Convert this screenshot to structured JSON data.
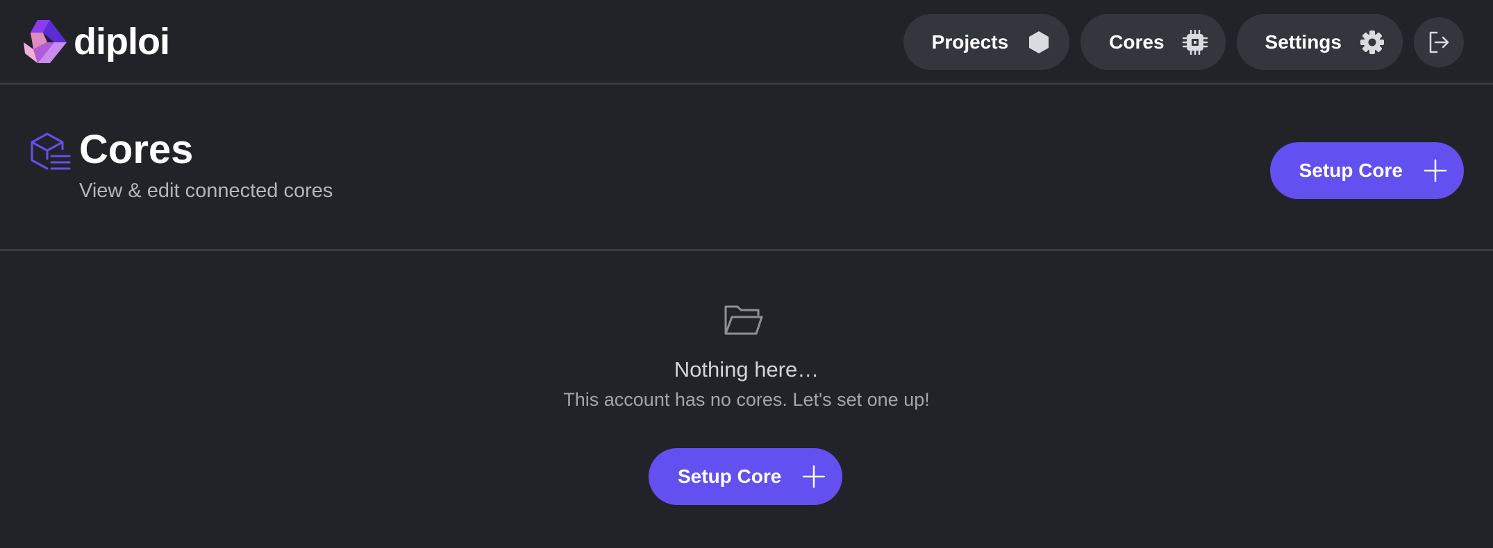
{
  "brand": {
    "name": "diploi"
  },
  "nav": {
    "items": [
      {
        "label": "Projects",
        "icon": "hexagon-icon"
      },
      {
        "label": "Cores",
        "icon": "chip-icon"
      },
      {
        "label": "Settings",
        "icon": "gear-icon"
      }
    ],
    "logout_icon": "logout-icon"
  },
  "page": {
    "title": "Cores",
    "subtitle": "View & edit connected cores",
    "icon": "cores-box-icon",
    "action_label": "Setup Core"
  },
  "empty_state": {
    "icon": "folder-open-icon",
    "title": "Nothing here…",
    "text": "This account has no cores. Let's set one up!",
    "action_label": "Setup Core"
  },
  "colors": {
    "background": "#222329",
    "accent": "#6250f0",
    "pill": "#34363d"
  }
}
